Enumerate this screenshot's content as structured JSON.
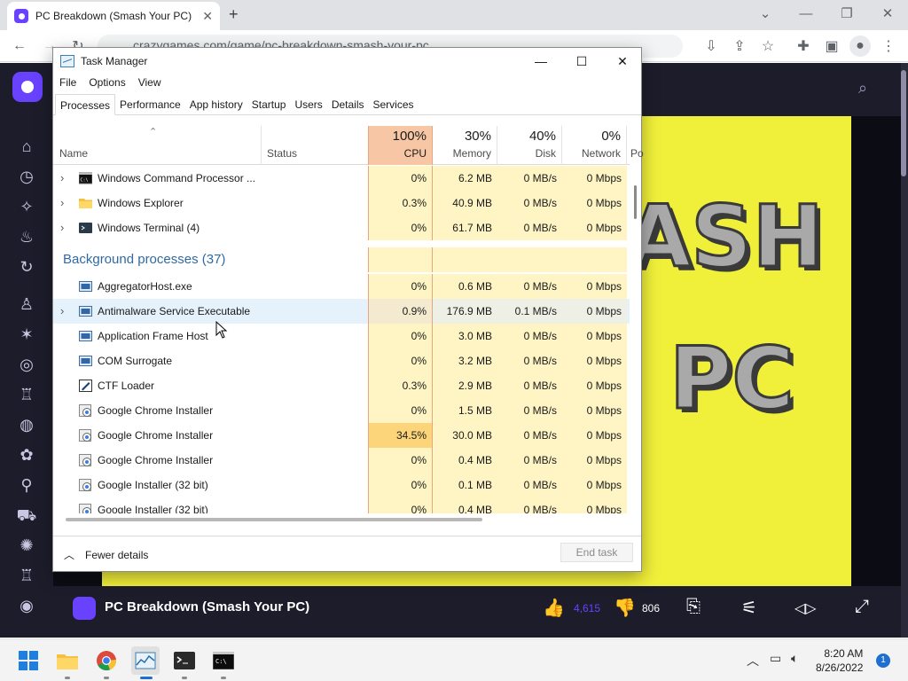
{
  "browser": {
    "tab_title": "PC Breakdown (Smash Your PC)",
    "url": "crazygames.com/game/pc-breakdown-smash-your-pc"
  },
  "game": {
    "title": "PC Breakdown (Smash Your PC)",
    "likes": "4,615",
    "dislikes": "806",
    "banner_line1": "ASH",
    "banner_line2": "PC"
  },
  "task_manager": {
    "title": "Task Manager",
    "menus": [
      "File",
      "Options",
      "View"
    ],
    "tabs": [
      "Processes",
      "Performance",
      "App history",
      "Startup",
      "Users",
      "Details",
      "Services"
    ],
    "active_tab": "Processes",
    "columns": {
      "name": "Name",
      "status": "Status",
      "cpu": {
        "pct": "100%",
        "label": "CPU"
      },
      "memory": {
        "pct": "30%",
        "label": "Memory"
      },
      "disk": {
        "pct": "40%",
        "label": "Disk"
      },
      "network": {
        "pct": "0%",
        "label": "Network"
      },
      "power": "Po"
    },
    "apps": [
      {
        "name": "Windows Command Processor ...",
        "cpu": "0%",
        "memory": "6.2 MB",
        "disk": "0 MB/s",
        "network": "0 Mbps",
        "expandable": true,
        "icon": "cmd-icon"
      },
      {
        "name": "Windows Explorer",
        "cpu": "0.3%",
        "memory": "40.9 MB",
        "disk": "0 MB/s",
        "network": "0 Mbps",
        "expandable": true,
        "icon": "folder-icon"
      },
      {
        "name": "Windows Terminal (4)",
        "cpu": "0%",
        "memory": "61.7 MB",
        "disk": "0 MB/s",
        "network": "0 Mbps",
        "expandable": true,
        "icon": "terminal-icon"
      }
    ],
    "background_group": "Background processes (37)",
    "background": [
      {
        "name": "AggregatorHost.exe",
        "cpu": "0%",
        "memory": "0.6 MB",
        "disk": "0 MB/s",
        "network": "0 Mbps",
        "expandable": false,
        "icon": "service-icon"
      },
      {
        "name": "Antimalware Service Executable",
        "cpu": "0.9%",
        "memory": "176.9 MB",
        "disk": "0.1 MB/s",
        "network": "0 Mbps",
        "expandable": true,
        "icon": "service-icon"
      },
      {
        "name": "Application Frame Host",
        "cpu": "0%",
        "memory": "3.0 MB",
        "disk": "0 MB/s",
        "network": "0 Mbps",
        "expandable": false,
        "icon": "service-icon"
      },
      {
        "name": "COM Surrogate",
        "cpu": "0%",
        "memory": "3.2 MB",
        "disk": "0 MB/s",
        "network": "0 Mbps",
        "expandable": false,
        "icon": "service-icon"
      },
      {
        "name": "CTF Loader",
        "cpu": "0.3%",
        "memory": "2.9 MB",
        "disk": "0 MB/s",
        "network": "0 Mbps",
        "expandable": false,
        "icon": "pen-icon"
      },
      {
        "name": "Google Chrome Installer",
        "cpu": "0%",
        "memory": "1.5 MB",
        "disk": "0 MB/s",
        "network": "0 Mbps",
        "expandable": false,
        "icon": "installer-icon"
      },
      {
        "name": "Google Chrome Installer",
        "cpu": "34.5%",
        "memory": "30.0 MB",
        "disk": "0 MB/s",
        "network": "0 Mbps",
        "expandable": false,
        "icon": "installer-icon"
      },
      {
        "name": "Google Chrome Installer",
        "cpu": "0%",
        "memory": "0.4 MB",
        "disk": "0 MB/s",
        "network": "0 Mbps",
        "expandable": false,
        "icon": "installer-icon"
      },
      {
        "name": "Google Installer (32 bit)",
        "cpu": "0%",
        "memory": "0.1 MB",
        "disk": "0 MB/s",
        "network": "0 Mbps",
        "expandable": false,
        "icon": "installer-icon"
      },
      {
        "name": "Google Installer (32 bit)",
        "cpu": "0%",
        "memory": "0.4 MB",
        "disk": "0 MB/s",
        "network": "0 Mbps",
        "expandable": false,
        "icon": "installer-icon"
      }
    ],
    "fewer_details": "Fewer details",
    "end_task": "End task"
  },
  "taskbar": {
    "time": "8:20 AM",
    "date": "8/26/2022",
    "notifications": "1"
  },
  "colors": {
    "cpu_header": "#f7c6a4",
    "cell_light": "#fff4c4",
    "cell_hot": "#fcd57a",
    "brand": "#6842ff",
    "game_bg": "#f0ef3a"
  }
}
